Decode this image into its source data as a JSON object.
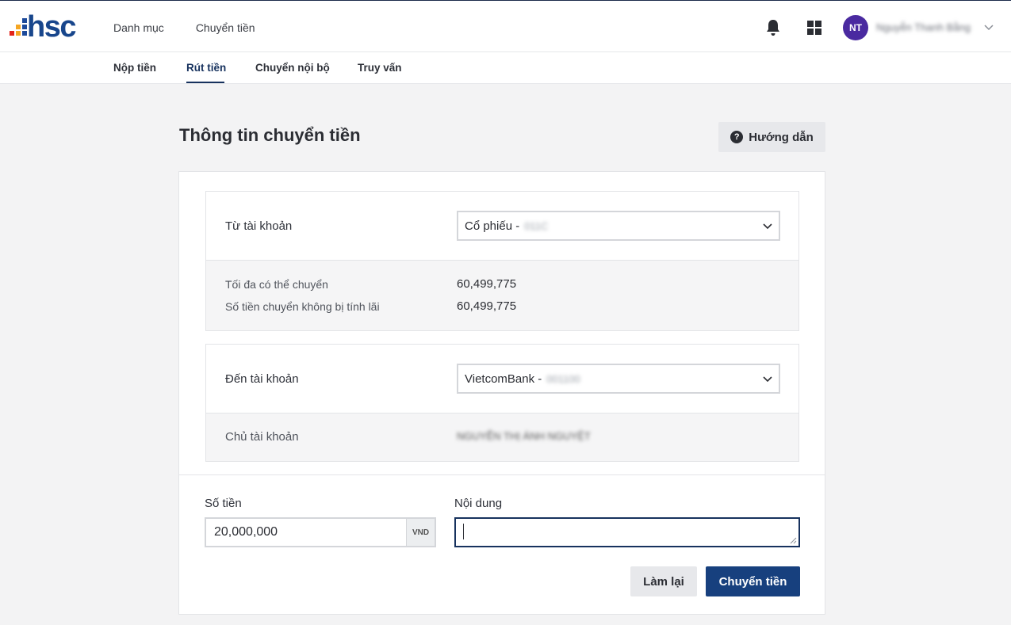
{
  "brand": {
    "logo_text": "hsc",
    "color": "#18468c"
  },
  "topnav": {
    "items": [
      "Danh mục",
      "Chuyển tiền"
    ]
  },
  "user": {
    "initials": "NT",
    "name": "Nguyễn Thanh Bằng"
  },
  "subnav": {
    "items": [
      "Nộp tiền",
      "Rút tiền",
      "Chuyển nội bộ",
      "Truy vấn"
    ],
    "active": "Rút tiền"
  },
  "page": {
    "title": "Thông tin chuyển tiền",
    "guide_label": "Hướng dẫn",
    "guide_icon": "?"
  },
  "from": {
    "label": "Từ tài khoản",
    "selected": "Cổ phiếu -",
    "selected_hidden": "011C",
    "max_label": "Tối đa có thể chuyển",
    "max_value": "60,499,775",
    "nointerest_label": "Số tiền chuyển không bị tính lãi",
    "nointerest_value": "60,499,775"
  },
  "to": {
    "label": "Đến tài khoản",
    "selected": "VietcomBank -",
    "selected_hidden": "001100",
    "owner_label": "Chủ tài khoản",
    "owner_value": "NGUYỄN THỊ ÁNH NGUYỆT"
  },
  "form": {
    "amount_label": "Số tiền",
    "amount_value": "20,000,000",
    "amount_unit": "VND",
    "content_label": "Nội dung",
    "content_value": "",
    "reset_label": "Làm lại",
    "submit_label": "Chuyển tiền"
  },
  "colors": {
    "primary": "#17407e",
    "avatar": "#4a2aa0"
  }
}
